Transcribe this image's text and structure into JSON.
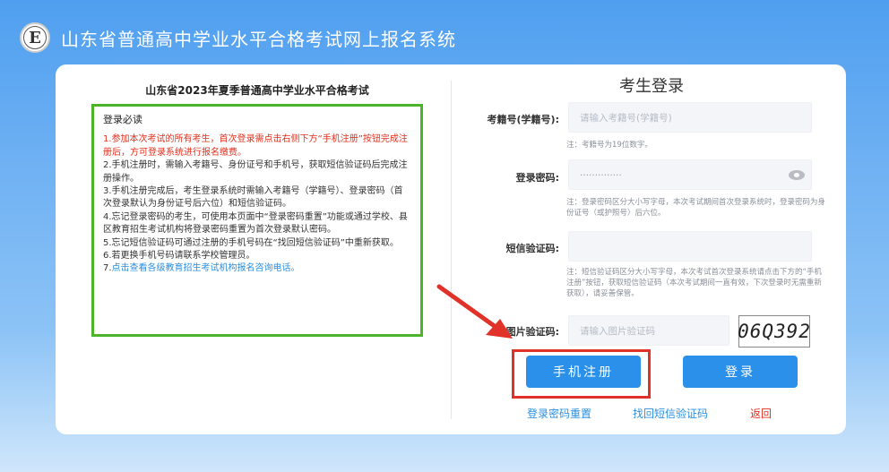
{
  "header": {
    "logo_glyph": "E",
    "title": "山东省普通高中学业水平合格考试网上报名系统"
  },
  "notice": {
    "title": "山东省2023年夏季普通高中学业水平合格考试",
    "heading": "登录必读",
    "items": [
      "1.参加本次考试的所有考生，首次登录需点击右侧下方“手机注册”按钮完成注册后，方可登录系统进行报名缴费。",
      "2.手机注册时，需输入考籍号、身份证号和手机号，获取短信验证码后完成注册操作。",
      "3.手机注册完成后，考生登录系统时需输入考籍号（学籍号）、登录密码（首次登录默认为身份证号后六位）和短信验证码。",
      "4.忘记登录密码的考生，可使用本页面中“登录密码重置”功能或通过学校、县区教育招生考试机构将登录密码重置为首次登录默认密码。",
      "5.忘记短信验证码可通过注册的手机号码在“找回短信验证码”中重新获取。",
      "6.若更换手机号码请联系学校管理员。"
    ],
    "item7_prefix": "7.",
    "item7_link": "点击查看各级教育招生考试机构报名咨询电话。"
  },
  "login": {
    "title": "考生登录",
    "exam_id_label": "考籍号(学籍号):",
    "exam_id_placeholder": "请输入考籍号(学籍号)",
    "exam_id_hint": "注：考籍号为19位数字。",
    "password_label": "登录密码:",
    "password_value": "··············",
    "password_hint": "注：登录密码区分大小写字母，本次考试期间首次登录系统时，登录密码为身份证号（或护照号）后六位。",
    "sms_label": "短信验证码:",
    "sms_placeholder": "",
    "sms_hint": "注：短信验证码区分大小写字母，本次考试首次登录系统请点击下方的“手机注册”按钮，获取短信验证码（本次考试期间一直有效，下次登录时无需重新获取），请妥善保管。",
    "captcha_label": "图片验证码:",
    "captcha_placeholder": "请输入图片验证码",
    "captcha_text": "06Q392",
    "register_button": "手机注册",
    "login_button": "登录",
    "reset_password_link": "登录密码重置",
    "recover_sms_link": "找回短信验证码",
    "back_link": "返回"
  },
  "colors": {
    "primary_button": "#2b90ea",
    "notice_border": "#4ab52a",
    "highlight_frame": "#e03228",
    "alert_text": "#e0301e"
  }
}
